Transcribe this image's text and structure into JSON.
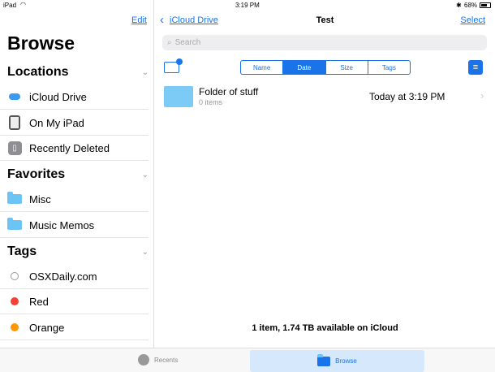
{
  "status": {
    "device": "iPad",
    "time": "3:19 PM",
    "battery": "68%"
  },
  "sidebar": {
    "edit": "Edit",
    "title": "Browse",
    "sections": [
      {
        "title": "Locations",
        "items": [
          {
            "label": "iCloud Drive",
            "icon": "cloud-icon"
          },
          {
            "label": "On My iPad",
            "icon": "ipad-icon"
          },
          {
            "label": "Recently Deleted",
            "icon": "trash-icon"
          }
        ]
      },
      {
        "title": "Favorites",
        "items": [
          {
            "label": "Misc",
            "icon": "folder-icon"
          },
          {
            "label": "Music Memos",
            "icon": "folder-icon"
          }
        ]
      },
      {
        "title": "Tags",
        "items": [
          {
            "label": "OSXDaily.com",
            "color": "#ffffff"
          },
          {
            "label": "Red",
            "color": "#f44336"
          },
          {
            "label": "Orange",
            "color": "#ff9500"
          }
        ]
      }
    ]
  },
  "main": {
    "back": "iCloud Drive",
    "title": "Test",
    "select": "Select",
    "search_placeholder": "Search",
    "sort": [
      "Name",
      "Date",
      "Size",
      "Tags"
    ],
    "sort_selected": "Date",
    "files": [
      {
        "name": "Folder of stuff",
        "sub": "0 items",
        "date": "Today at 3:19 PM"
      }
    ],
    "footer": "1 item, 1.74 TB available on iCloud"
  },
  "tabs": [
    {
      "label": "Recents"
    },
    {
      "label": "Browse"
    }
  ],
  "accent": "#1a73e8"
}
